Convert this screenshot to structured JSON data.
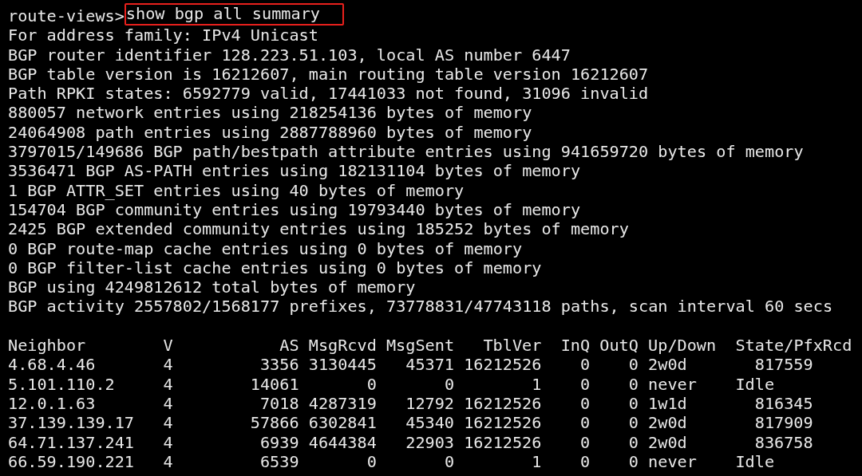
{
  "prompt": {
    "host": "route-views>",
    "command": "show bgp all summary",
    "highlighted": true
  },
  "output_lines": [
    "For address family: IPv4 Unicast",
    "BGP router identifier 128.223.51.103, local AS number 6447",
    "BGP table version is 16212607, main routing table version 16212607",
    "Path RPKI states: 6592779 valid, 17441033 not found, 31096 invalid",
    "880057 network entries using 218254136 bytes of memory",
    "24064908 path entries using 2887788960 bytes of memory",
    "3797015/149686 BGP path/bestpath attribute entries using 941659720 bytes of memory",
    "3536471 BGP AS-PATH entries using 182131104 bytes of memory",
    "1 BGP ATTR_SET entries using 40 bytes of memory",
    "154704 BGP community entries using 19793440 bytes of memory",
    "2425 BGP extended community entries using 185252 bytes of memory",
    "0 BGP route-map cache entries using 0 bytes of memory",
    "0 BGP filter-list cache entries using 0 bytes of memory",
    "BGP using 4249812612 total bytes of memory",
    "BGP activity 2557802/1568177 prefixes, 73778831/47743118 paths, scan interval 60 secs"
  ],
  "table": {
    "columns": [
      "Neighbor",
      "V",
      "AS",
      "MsgRcvd",
      "MsgSent",
      "TblVer",
      "InQ",
      "OutQ",
      "Up/Down",
      "State/PfxRcd"
    ],
    "rows": [
      {
        "cells": [
          "4.68.4.46",
          "4",
          "3356",
          "3130445",
          "45371",
          "16212526",
          "0",
          "0",
          "2w0d"
        ],
        "state": {
          "kind": "count",
          "text": "817559"
        }
      },
      {
        "cells": [
          "5.101.110.2",
          "4",
          "14061",
          "0",
          "0",
          "1",
          "0",
          "0",
          "never"
        ],
        "state": {
          "kind": "state",
          "text": "Idle"
        }
      },
      {
        "cells": [
          "12.0.1.63",
          "4",
          "7018",
          "4287319",
          "12792",
          "16212526",
          "0",
          "0",
          "1w1d"
        ],
        "state": {
          "kind": "count",
          "text": "816345"
        }
      },
      {
        "cells": [
          "37.139.139.17",
          "4",
          "57866",
          "6302841",
          "45340",
          "16212526",
          "0",
          "0",
          "2w0d"
        ],
        "state": {
          "kind": "count",
          "text": "817909"
        }
      },
      {
        "cells": [
          "64.71.137.241",
          "4",
          "6939",
          "4644384",
          "22903",
          "16212526",
          "0",
          "0",
          "2w0d"
        ],
        "state": {
          "kind": "count",
          "text": "836758"
        }
      },
      {
        "cells": [
          "66.59.190.221",
          "4",
          "6539",
          "0",
          "0",
          "1",
          "0",
          "0",
          "never"
        ],
        "state": {
          "kind": "state",
          "text": "Idle"
        }
      }
    ]
  }
}
